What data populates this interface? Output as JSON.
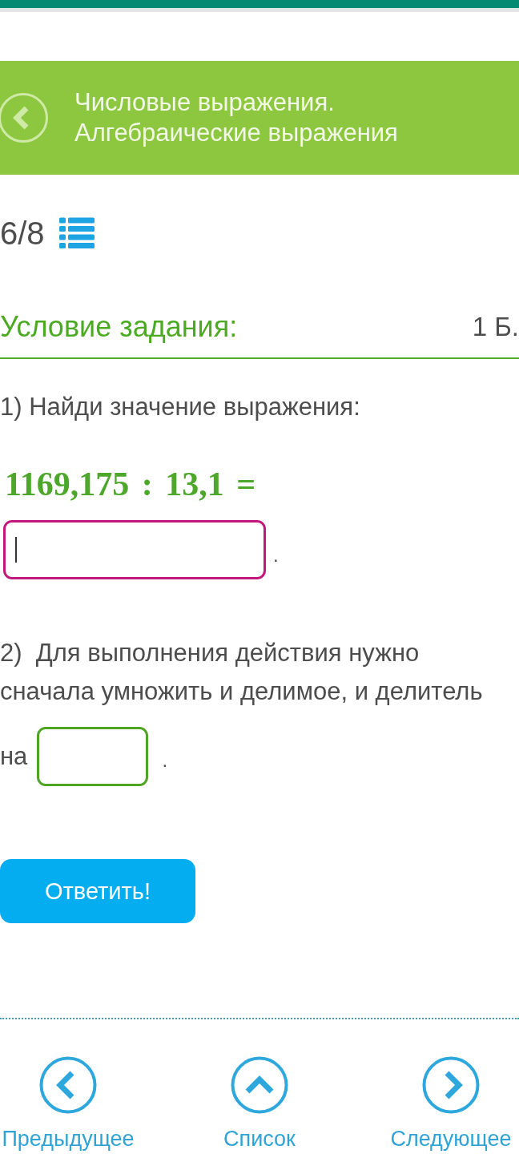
{
  "header": {
    "title": "Числовые выражения. Алгебраические выражения"
  },
  "progress": {
    "text": "6/8"
  },
  "task": {
    "heading": "Условие задания:",
    "points": "1 Б."
  },
  "questions": [
    {
      "kind": "expression",
      "prompt": "1) Найди значение выражения:",
      "expression": "1169,175 : 13,1 =",
      "answer": {
        "focused": true
      },
      "after": "."
    },
    {
      "kind": "fill_in",
      "text": "2)  Для выполнения действия нужно сначала умножить и делимое, и делитель",
      "field_label": "на",
      "answer": {
        "focused": false
      },
      "after": "."
    }
  ],
  "submit_button": {
    "label": "Ответить!"
  },
  "nav": [
    {
      "kind": "previous",
      "label": "Предыдущее"
    },
    {
      "kind": "list",
      "label": "Список"
    },
    {
      "kind": "next",
      "label": "Следующее"
    }
  ]
}
